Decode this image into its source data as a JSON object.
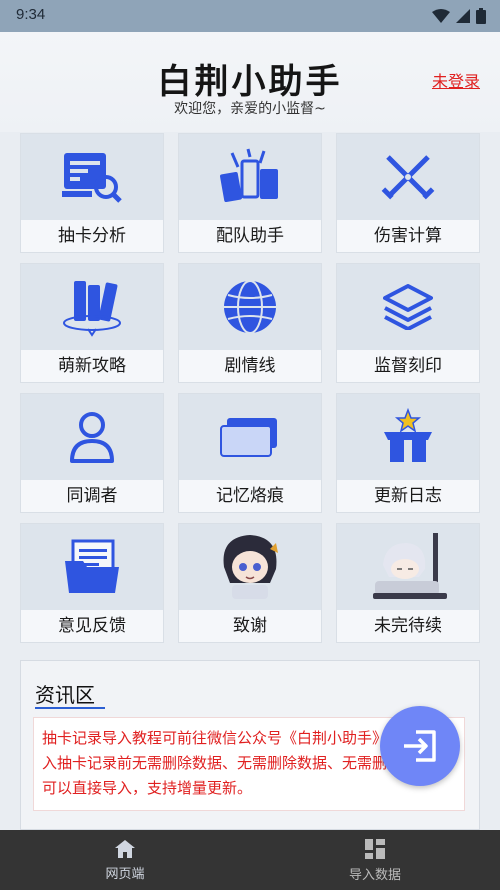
{
  "status_bar": {
    "time": "9:34"
  },
  "header": {
    "app_title": "白荆小助手",
    "welcome": "欢迎您，亲爱的小监督~",
    "login_link": "未登录"
  },
  "tiles": [
    {
      "label": "抽卡分析",
      "icon": "gacha-analysis-icon"
    },
    {
      "label": "配队助手",
      "icon": "team-helper-icon"
    },
    {
      "label": "伤害计算",
      "icon": "damage-calc-icon"
    },
    {
      "label": "萌新攻略",
      "icon": "books-icon"
    },
    {
      "label": "剧情线",
      "icon": "globe-icon"
    },
    {
      "label": "监督刻印",
      "icon": "layers-icon"
    },
    {
      "label": "同调者",
      "icon": "user-icon"
    },
    {
      "label": "记忆烙痕",
      "icon": "card-icon"
    },
    {
      "label": "更新日志",
      "icon": "gift-box-icon"
    },
    {
      "label": "意见反馈",
      "icon": "folder-icon"
    },
    {
      "label": "致谢",
      "icon": "chibi-character-icon"
    },
    {
      "label": "未完待续",
      "icon": "chibi-sleeping-icon"
    }
  ],
  "news": {
    "title": "资讯区",
    "text": "抽卡记录导入教程可前往微信公众号《白荆小助手》查看，导入抽卡记录前无需删除数据、无需删除数据、无需删除数据。可以直接导入，支持增量更新。"
  },
  "bottom_nav": [
    {
      "label": "网页端",
      "icon": "home-icon",
      "active": true
    },
    {
      "label": "导入数据",
      "icon": "grid-icon",
      "active": false
    }
  ],
  "colors": {
    "accent_blue": "#2f55e0",
    "warning_red": "#e02020",
    "fab": "#6f86f7",
    "nav_bg": "#343434"
  }
}
